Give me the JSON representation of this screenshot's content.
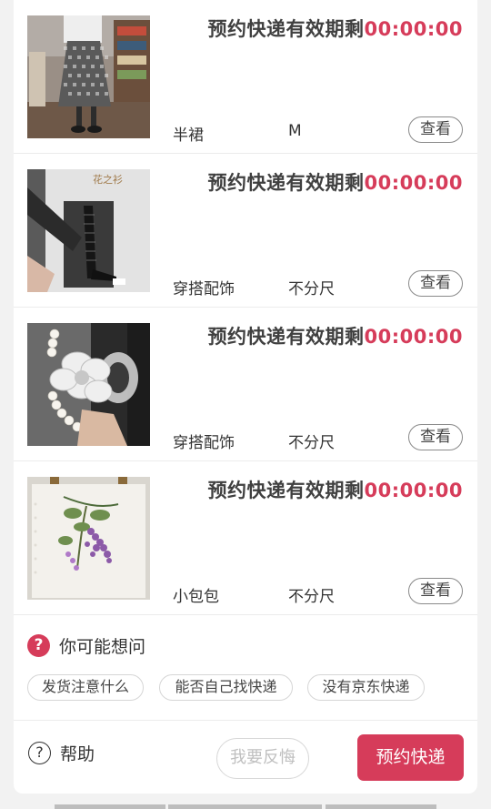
{
  "colors": {
    "accent": "#d63c5a"
  },
  "orders": [
    {
      "notice": "预约快递有效期剩",
      "timer": "00:00:00",
      "category": "半裙",
      "size": "M",
      "view_label": "查看",
      "image": "skirt-photo"
    },
    {
      "notice": "预约快递有效期剩",
      "timer": "00:00:00",
      "category": "穿搭配饰",
      "size": "不分尺",
      "view_label": "查看",
      "image": "stockings-photo"
    },
    {
      "notice": "预约快递有效期剩",
      "timer": "00:00:00",
      "category": "穿搭配饰",
      "size": "不分尺",
      "view_label": "查看",
      "image": "hair-clip-photo"
    },
    {
      "notice": "预约快递有效期剩",
      "timer": "00:00:00",
      "category": "小包包",
      "size": "不分尺",
      "view_label": "查看",
      "image": "tote-bag-photo"
    }
  ],
  "faq": {
    "badge": "?",
    "title": "你可能想问",
    "questions": [
      "发货注意什么",
      "能否自己找快递",
      "没有京东快递"
    ]
  },
  "footer": {
    "help_icon": "?",
    "help_label": "帮助",
    "regret_label": "我要反悔",
    "book_label": "预约快递"
  }
}
